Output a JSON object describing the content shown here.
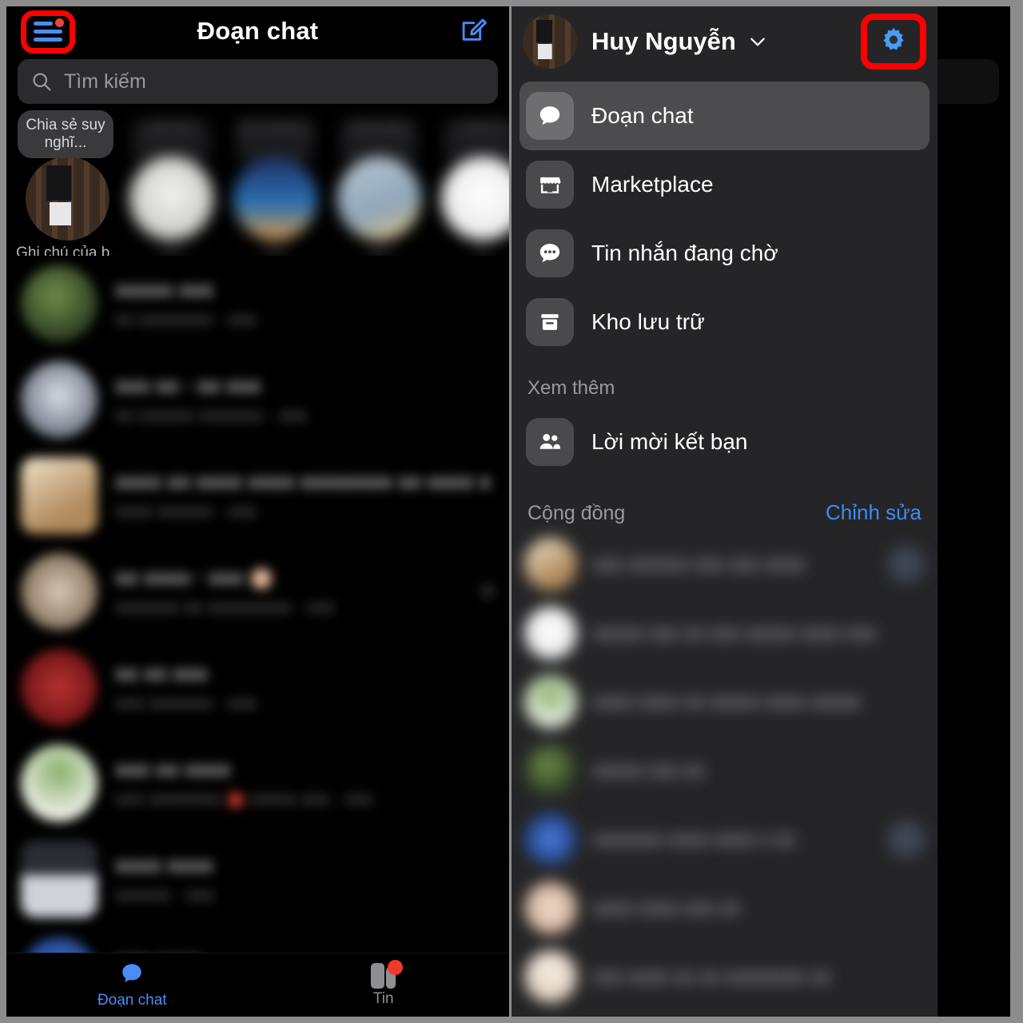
{
  "left_screen": {
    "header": {
      "title": "Đoạn chat",
      "menu_icon": "hamburger-menu-icon",
      "menu_badge": true,
      "compose_icon": "compose-new-message-icon"
    },
    "search": {
      "placeholder": "Tìm kiếm",
      "icon": "search-icon"
    },
    "notes_row": {
      "self_note_bubble": "Chia sẻ suy nghĩ...",
      "self_note_label": "Ghi chú của b..",
      "others": [
        {
          "label": "",
          "caption": ""
        },
        {
          "label": "",
          "caption": ""
        },
        {
          "label": "",
          "caption": ""
        },
        {
          "label": "",
          "caption": ""
        }
      ]
    },
    "chats": [
      {
        "name": "",
        "preview": "",
        "has_red_dot": false,
        "has_emoji": false
      },
      {
        "name": "",
        "preview": "",
        "has_red_dot": false,
        "has_emoji": false
      },
      {
        "name": "",
        "preview": "",
        "has_red_dot": false,
        "has_emoji": false
      },
      {
        "name": "",
        "preview": "",
        "has_red_dot": false,
        "has_emoji": true
      },
      {
        "name": "",
        "preview": "",
        "has_red_dot": false,
        "has_emoji": false
      },
      {
        "name": "",
        "preview": "",
        "has_red_dot": true,
        "has_emoji": false
      },
      {
        "name": "",
        "preview": "",
        "has_red_dot": false,
        "has_emoji": false
      }
    ],
    "tabbar": [
      {
        "label": "Đoạn chat",
        "icon": "chat-bubble-icon",
        "active": true,
        "badge": false
      },
      {
        "label": "Tin",
        "icon": "stories-icon",
        "active": false,
        "badge": true
      }
    ]
  },
  "right_screen": {
    "header": {
      "avatar": "user-avatar",
      "user_name": "Huy Nguyễn",
      "chevron_icon": "chevron-down-icon",
      "settings_icon": "gear-icon"
    },
    "menu": [
      {
        "label": "Đoạn chat",
        "icon": "chat-bubble-icon",
        "active": true
      },
      {
        "label": "Marketplace",
        "icon": "marketplace-icon",
        "active": false
      },
      {
        "label": "Tin nhắn đang chờ",
        "icon": "pending-messages-icon",
        "active": false
      },
      {
        "label": "Kho lưu trữ",
        "icon": "archive-box-icon",
        "active": false
      }
    ],
    "see_more_title": "Xem thêm",
    "see_more_items": [
      {
        "label": "Lời mời kết bạn",
        "icon": "friend-requests-icon"
      }
    ],
    "community": {
      "title": "Cộng đồng",
      "edit_label": "Chỉnh sửa",
      "rows": [
        {
          "name": "",
          "badge": true
        },
        {
          "name": "",
          "badge": false
        },
        {
          "name": "",
          "badge": false
        },
        {
          "name": "",
          "badge": false
        },
        {
          "name": "",
          "badge": true
        },
        {
          "name": "",
          "badge": false
        },
        {
          "name": "",
          "badge": false
        }
      ]
    }
  },
  "annotations": {
    "highlight_color": "#ff0000",
    "highlights": [
      {
        "target": "hamburger-menu-icon",
        "screen": "left"
      },
      {
        "target": "gear-icon",
        "screen": "right"
      }
    ]
  },
  "colors": {
    "accent_blue": "#4a8cf7",
    "link_blue": "#3d8bf5",
    "badge_red": "#e8453c",
    "drawer_bg": "#252527",
    "screen_bg": "#000000"
  }
}
